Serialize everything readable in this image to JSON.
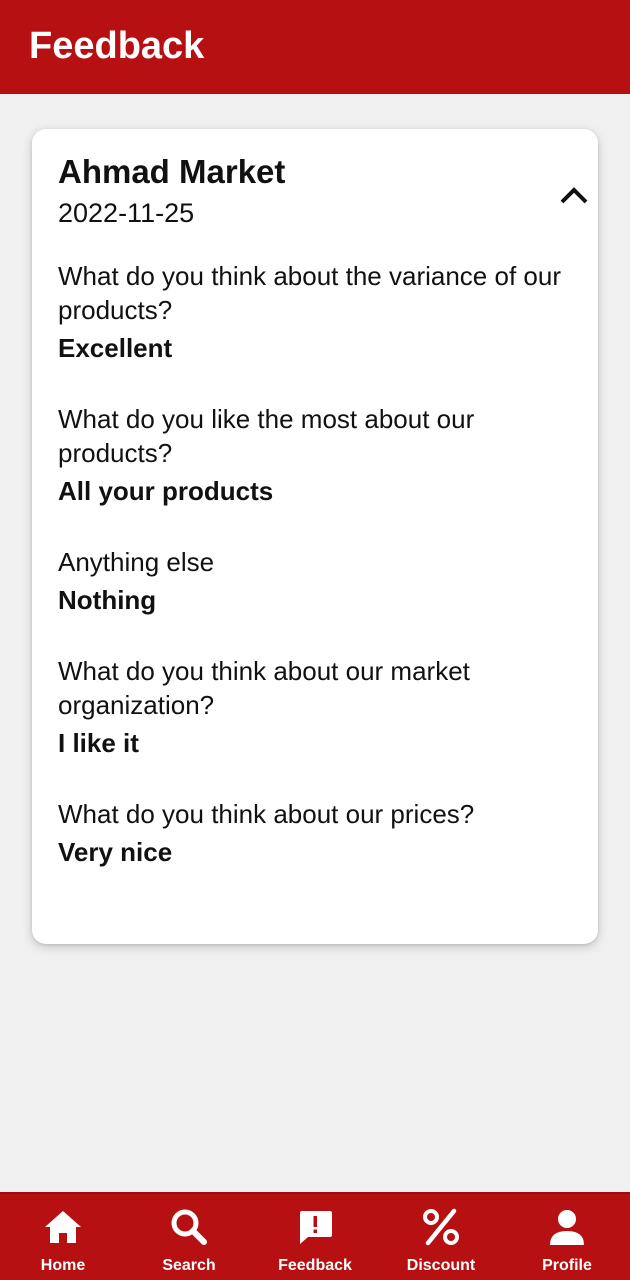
{
  "app_bar": {
    "title": "Feedback"
  },
  "feedback_card": {
    "market_name": "Ahmad Market",
    "date": "2022-11-25",
    "toggle_icon": "chevron-up-icon",
    "items": [
      {
        "question": "What do you think about the variance of our products?",
        "answer": "Excellent"
      },
      {
        "question": "What do you like the most about our products?",
        "answer": "All your products"
      },
      {
        "question": "Anything else",
        "answer": "Nothing"
      },
      {
        "question": "What do you think about our market organization?",
        "answer": "I like it"
      },
      {
        "question": "What do you think about our prices?",
        "answer": "Very nice"
      }
    ]
  },
  "bottom_nav": {
    "items": [
      {
        "label": "Home",
        "icon": "home-icon"
      },
      {
        "label": "Search",
        "icon": "search-icon"
      },
      {
        "label": "Feedback",
        "icon": "feedback-icon"
      },
      {
        "label": "Discount",
        "icon": "percent-icon"
      },
      {
        "label": "Profile",
        "icon": "person-icon"
      }
    ]
  },
  "colors": {
    "primary": "#b71013",
    "background": "#f0f0f0",
    "card": "#ffffff",
    "on_primary": "#ffffff"
  }
}
